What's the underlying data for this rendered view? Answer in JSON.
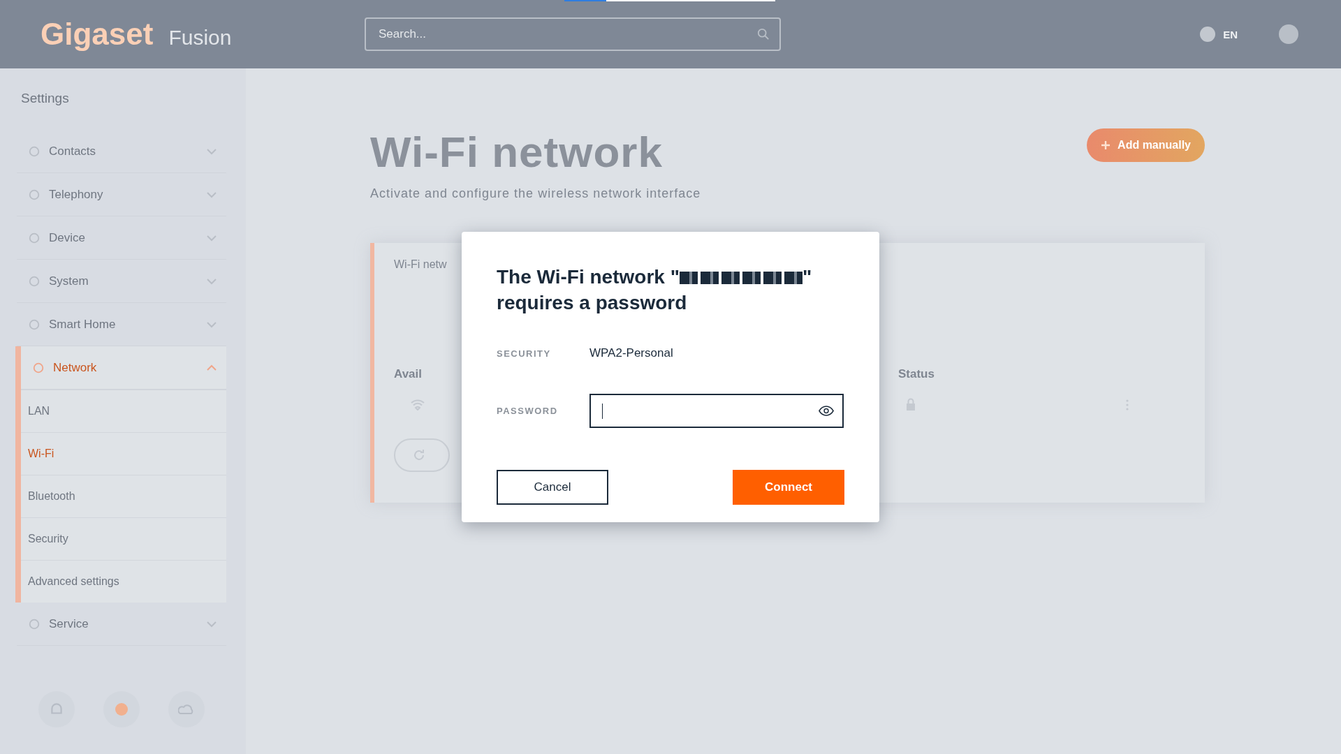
{
  "loading_bar": {
    "level": 0.2
  },
  "header": {
    "logo": "Gigaset",
    "product": "Fusion",
    "search": {
      "placeholder": "Search..."
    },
    "language": "EN"
  },
  "sidebar": {
    "title": "Settings",
    "items": [
      {
        "label": "Contacts",
        "expanded": false,
        "selected": false
      },
      {
        "label": "Telephony",
        "expanded": false,
        "selected": false
      },
      {
        "label": "Device",
        "expanded": false,
        "selected": false
      },
      {
        "label": "System",
        "expanded": false,
        "selected": false
      },
      {
        "label": "Smart Home",
        "expanded": false,
        "selected": false
      },
      {
        "label": "Network",
        "expanded": true,
        "selected": true,
        "children": [
          {
            "label": "LAN",
            "selected": false
          },
          {
            "label": "Wi-Fi",
            "selected": true
          },
          {
            "label": "Bluetooth",
            "selected": false
          },
          {
            "label": "Security",
            "selected": false
          },
          {
            "label": "Advanced settings",
            "selected": false
          }
        ]
      },
      {
        "label": "Service",
        "expanded": false,
        "selected": false
      }
    ]
  },
  "page": {
    "title": "Wi-Fi network",
    "subtitle": "Activate and configure the wireless network interface",
    "add_button": "Add manually",
    "card": {
      "title": "Wi-Fi netw",
      "columns": [
        "Avail",
        "Status"
      ]
    }
  },
  "dialog": {
    "title_start": "The Wi-Fi network \"",
    "title_end": "\" requires a password",
    "security_label": "SECURITY",
    "security_value": "WPA2-Personal",
    "password_label": "PASSWORD",
    "cancel": "Cancel",
    "connect": "Connect"
  }
}
